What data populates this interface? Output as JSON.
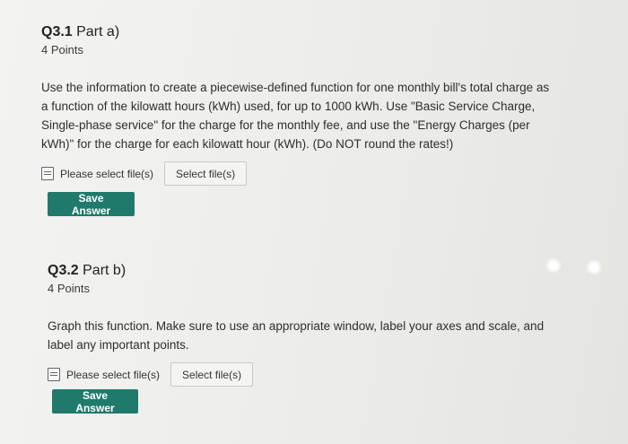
{
  "q1": {
    "number": "Q3.1",
    "part": " Part a)",
    "points": "4 Points",
    "body_lines": [
      "Use the information to create a piecewise-defined function for one monthly bill's total charge as",
      "a function of the kilowatt hours (kWh) used, for up to 1000 kWh.  Use \"Basic Service Charge,",
      "Single-phase service\" for the charge for the monthly fee, and use the \"Energy Charges (per",
      "kWh)\" for the charge for each kilowatt hour (kWh). (Do NOT round the rates!)"
    ],
    "file_label": "Please select file(s)",
    "select_button": "Select file(s)",
    "save_button": "Save Answer"
  },
  "q2": {
    "number": "Q3.2",
    "part": " Part b)",
    "points": "4 Points",
    "body_lines": [
      "Graph this function. Make sure to use an appropriate window, label your axes and scale, and",
      "label any important points."
    ],
    "file_label": "Please select file(s)",
    "select_button": "Select file(s)",
    "save_button": "Save Answer"
  },
  "colors": {
    "save_button_bg": "#1f7a6c",
    "background": "#ecece9"
  }
}
